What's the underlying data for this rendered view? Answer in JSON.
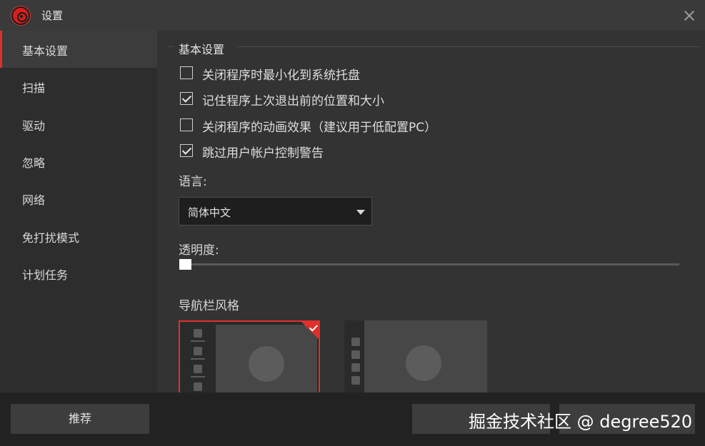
{
  "window": {
    "title": "设置"
  },
  "sidebar": {
    "items": [
      {
        "label": "基本设置",
        "active": true
      },
      {
        "label": "扫描"
      },
      {
        "label": "驱动"
      },
      {
        "label": "忽略"
      },
      {
        "label": "网络"
      },
      {
        "label": "免打扰模式"
      },
      {
        "label": "计划任务"
      }
    ]
  },
  "main": {
    "section_title": "基本设置",
    "options": [
      {
        "label": "关闭程序时最小化到系统托盘",
        "checked": false
      },
      {
        "label": "记住程序上次退出前的位置和大小",
        "checked": true
      },
      {
        "label": "关闭程序的动画效果（建议用于低配置PC）",
        "checked": false
      },
      {
        "label": "跳过用户帐户控制警告",
        "checked": true
      }
    ],
    "language": {
      "label": "语言:",
      "value": "简体中文"
    },
    "transparency": {
      "label": "透明度:",
      "value": 0
    },
    "nav_style": {
      "label": "导航栏风格",
      "selected": 0
    }
  },
  "footer": {
    "recommend_label": "推荐",
    "ok_label": "",
    "cancel_label": ""
  },
  "watermark": "掘金技术社区 @ degree520",
  "colors": {
    "accent": "#e0302c",
    "bg": "#333333",
    "sidebar": "#2d2d2d"
  }
}
